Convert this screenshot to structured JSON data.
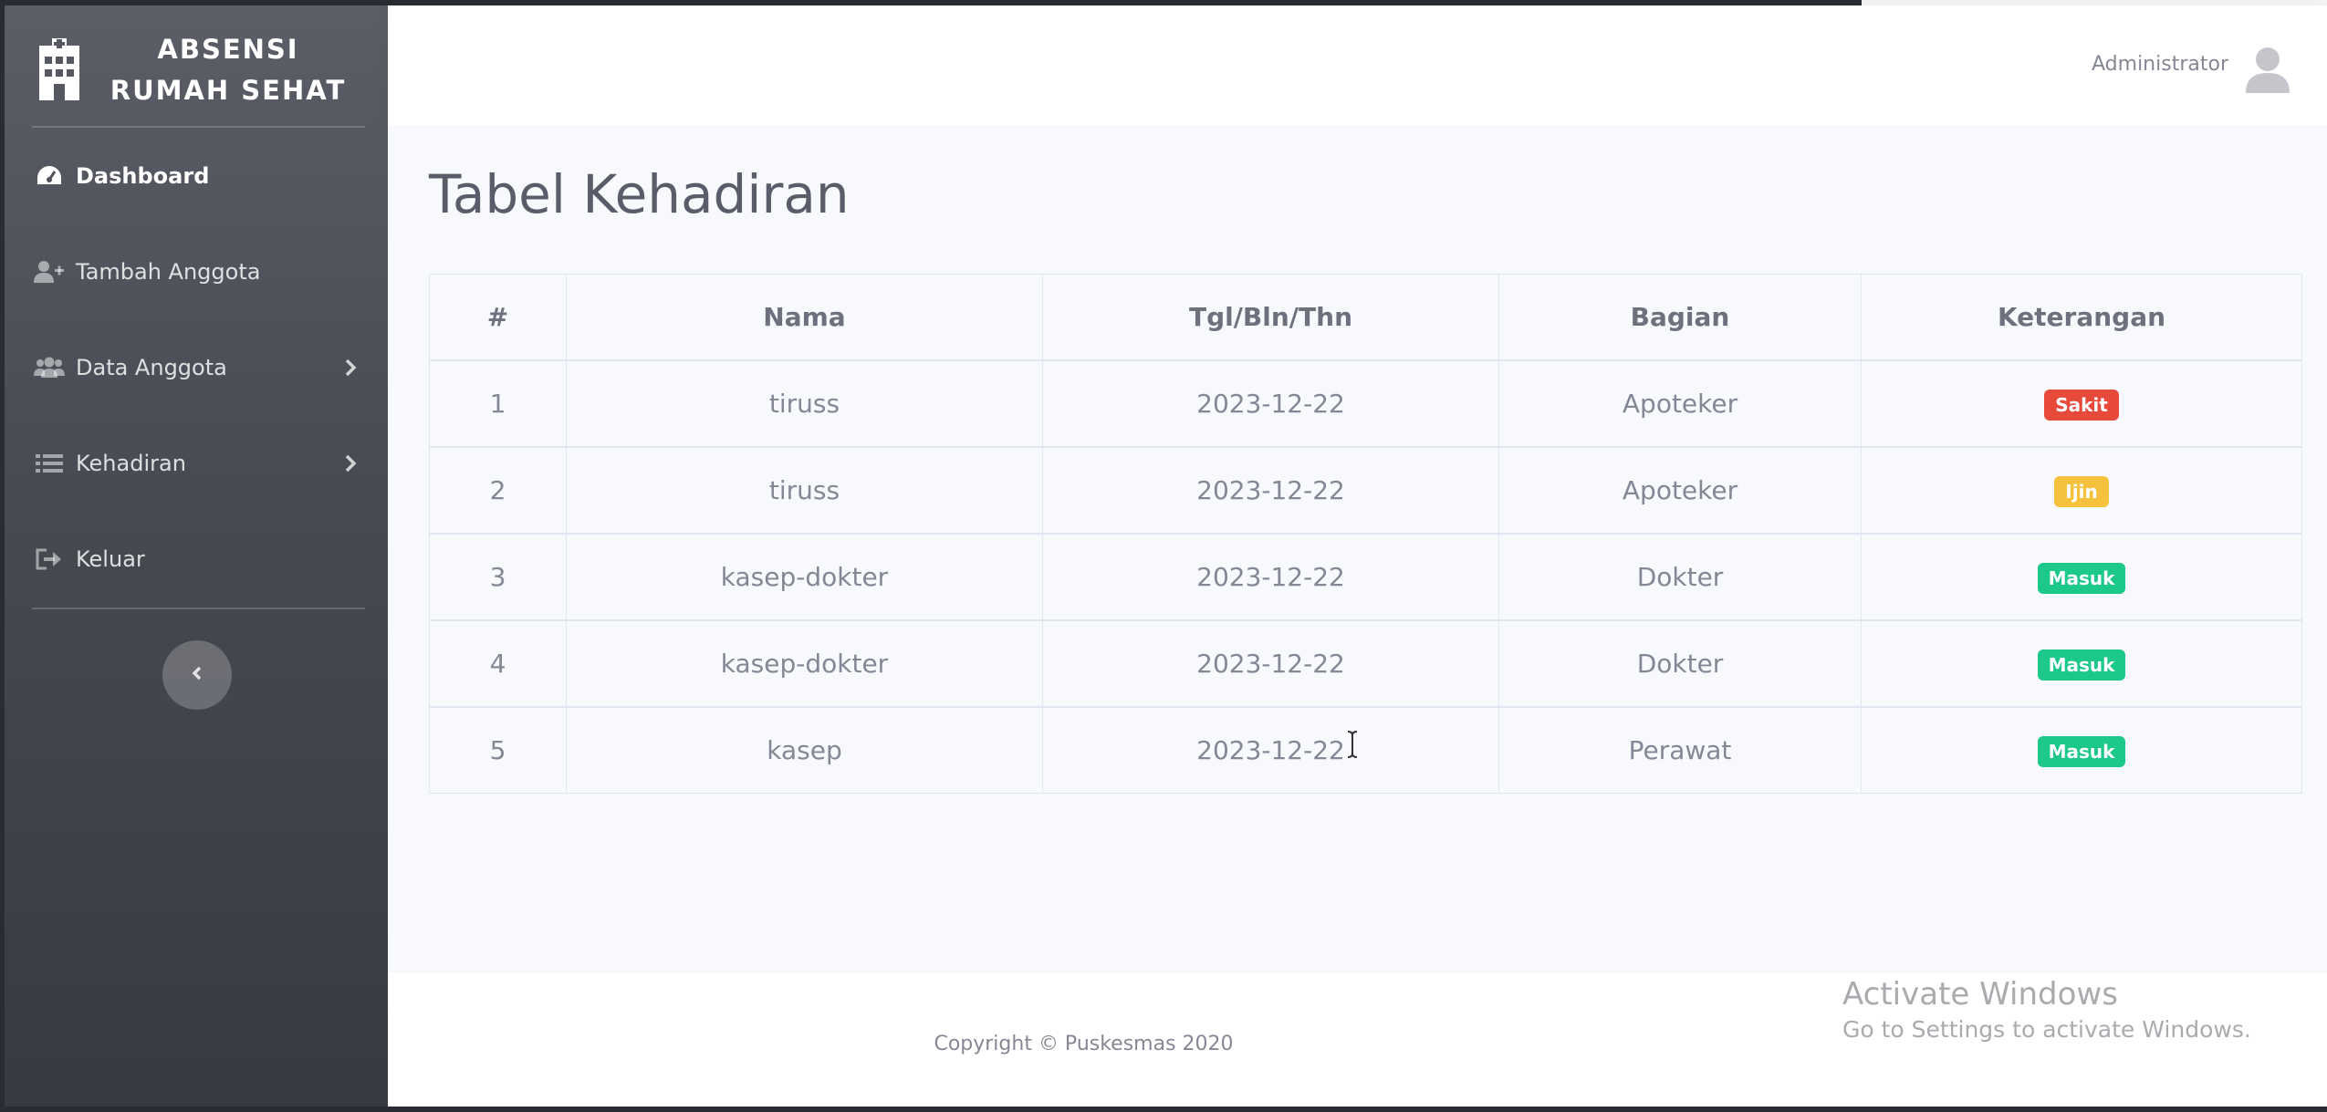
{
  "brand": {
    "line1": "ABSENSI",
    "line2": "RUMAH SEHAT",
    "icon": "hospital-icon"
  },
  "sidebar": {
    "items": [
      {
        "label": "Dashboard",
        "icon": "tachometer-icon",
        "active": true,
        "has_submenu": false
      },
      {
        "label": "Tambah Anggota",
        "icon": "user-plus-icon",
        "active": false,
        "has_submenu": false
      },
      {
        "label": "Data Anggota",
        "icon": "users-icon",
        "active": false,
        "has_submenu": true
      },
      {
        "label": "Kehadiran",
        "icon": "list-icon",
        "active": false,
        "has_submenu": true
      },
      {
        "label": "Keluar",
        "icon": "sign-out-icon",
        "active": false,
        "has_submenu": false
      }
    ],
    "toggle_icon": "chevron-left-icon"
  },
  "topbar": {
    "user_name": "Administrator",
    "avatar_icon": "user-avatar-icon"
  },
  "main": {
    "title": "Tabel Kehadiran",
    "table": {
      "columns": [
        "#",
        "Nama",
        "Tgl/Bln/Thn",
        "Bagian",
        "Keterangan"
      ],
      "rows": [
        {
          "no": "1",
          "nama": "tiruss",
          "tanggal": "2023-12-22",
          "bagian": "Apoteker",
          "keterangan": "Sakit",
          "status": "danger"
        },
        {
          "no": "2",
          "nama": "tiruss",
          "tanggal": "2023-12-22",
          "bagian": "Apoteker",
          "keterangan": "Ijin",
          "status": "warning"
        },
        {
          "no": "3",
          "nama": "kasep-dokter",
          "tanggal": "2023-12-22",
          "bagian": "Dokter",
          "keterangan": "Masuk",
          "status": "success"
        },
        {
          "no": "4",
          "nama": "kasep-dokter",
          "tanggal": "2023-12-22",
          "bagian": "Dokter",
          "keterangan": "Masuk",
          "status": "success"
        },
        {
          "no": "5",
          "nama": "kasep",
          "tanggal": "2023-12-22",
          "bagian": "Perawat",
          "keterangan": "Masuk",
          "status": "success"
        }
      ]
    }
  },
  "footer": {
    "copyright": "Copyright © Puskesmas 2020"
  },
  "watermark": {
    "title": "Activate Windows",
    "subtitle": "Go to Settings to activate Windows."
  },
  "colors": {
    "danger": "#e74a3b",
    "warning": "#f6c23e",
    "success": "#1cc88a",
    "text_muted": "#858796"
  }
}
